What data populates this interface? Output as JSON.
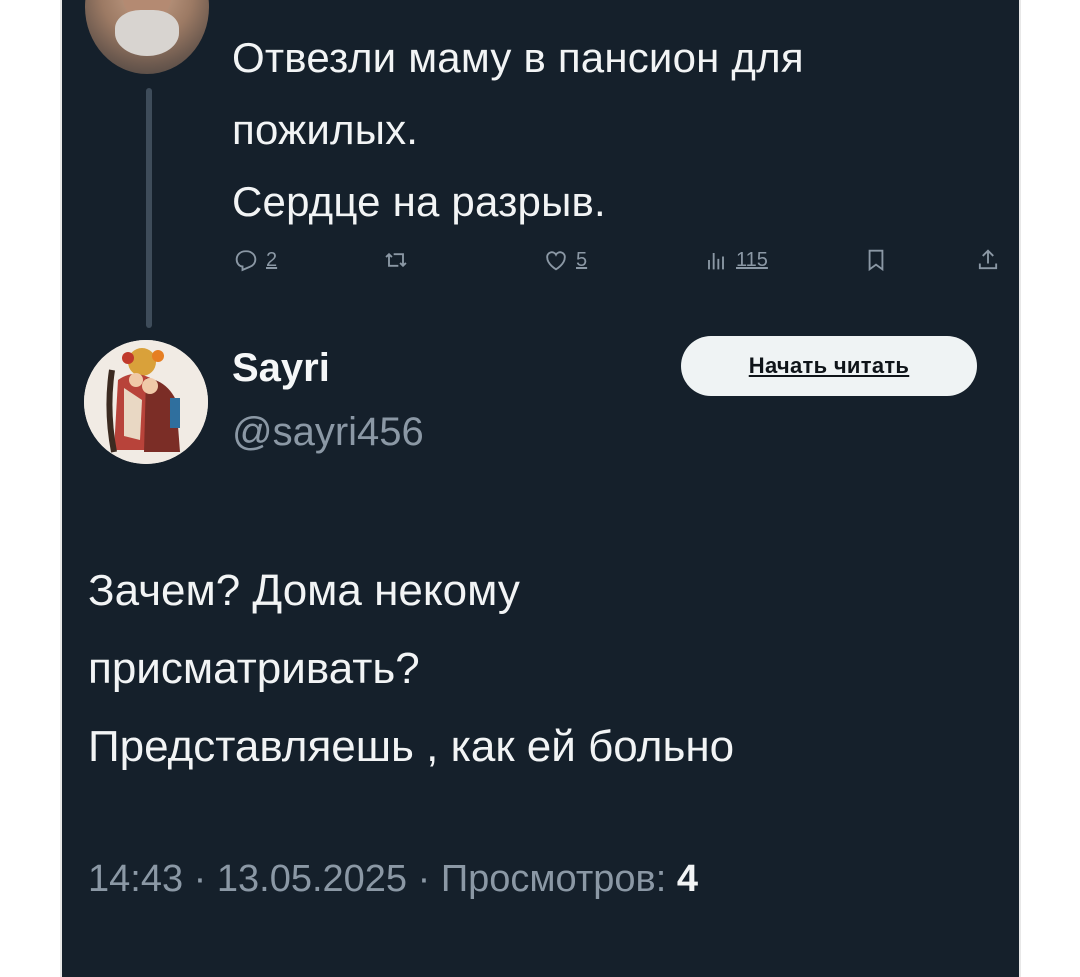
{
  "original_tweet": {
    "lines": [
      "Отвезли маму в пансион для",
      "пожилых.",
      "Сердце на разрыв."
    ],
    "actions": {
      "replies": "2",
      "retweets": "",
      "likes": "5",
      "views": "115"
    }
  },
  "reply": {
    "display_name": "Sayri",
    "handle": "@sayri456",
    "follow_label": "Начать читать",
    "lines": [
      "Зачем? Дома некому",
      "присматривать?",
      "Представляешь , как ей больно"
    ],
    "time": "14:43",
    "date": "13.05.2025",
    "views_label": "Просмотров:",
    "views_count": "4"
  },
  "colors": {
    "background": "#15202b",
    "text_primary": "#f2f4f5",
    "text_secondary": "#8b98a5",
    "button_bg": "#eff3f4"
  },
  "icons": [
    "reply-icon",
    "retweet-icon",
    "like-icon",
    "views-icon",
    "bookmark-icon",
    "share-icon"
  ]
}
